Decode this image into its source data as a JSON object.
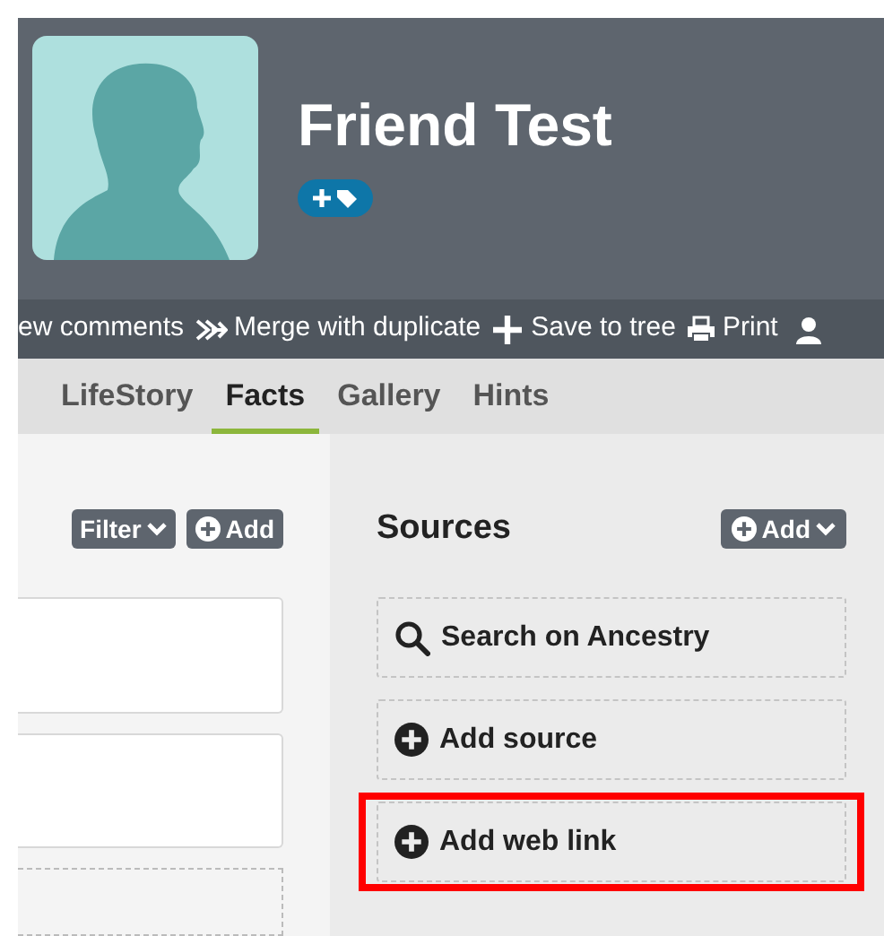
{
  "profile": {
    "name": "Friend Test"
  },
  "toolbar": [
    {
      "label": "ew comments"
    },
    {
      "label": "Merge with duplicate"
    },
    {
      "label": "Save to tree"
    },
    {
      "label": "Print"
    }
  ],
  "tabs": [
    {
      "label": "LifeStory",
      "selected": false
    },
    {
      "label": "Facts",
      "selected": true
    },
    {
      "label": "Gallery",
      "selected": false
    },
    {
      "label": "Hints",
      "selected": false
    }
  ],
  "facts": {
    "filter_button": "Filter",
    "add_button": "Add"
  },
  "sources": {
    "title": "Sources",
    "add_button": "Add",
    "items": [
      {
        "kind": "search",
        "label": "Search on Ancestry",
        "highlighted": false
      },
      {
        "kind": "add",
        "label": "Add source",
        "highlighted": false
      },
      {
        "kind": "add",
        "label": "Add web link",
        "highlighted": true
      }
    ]
  }
}
